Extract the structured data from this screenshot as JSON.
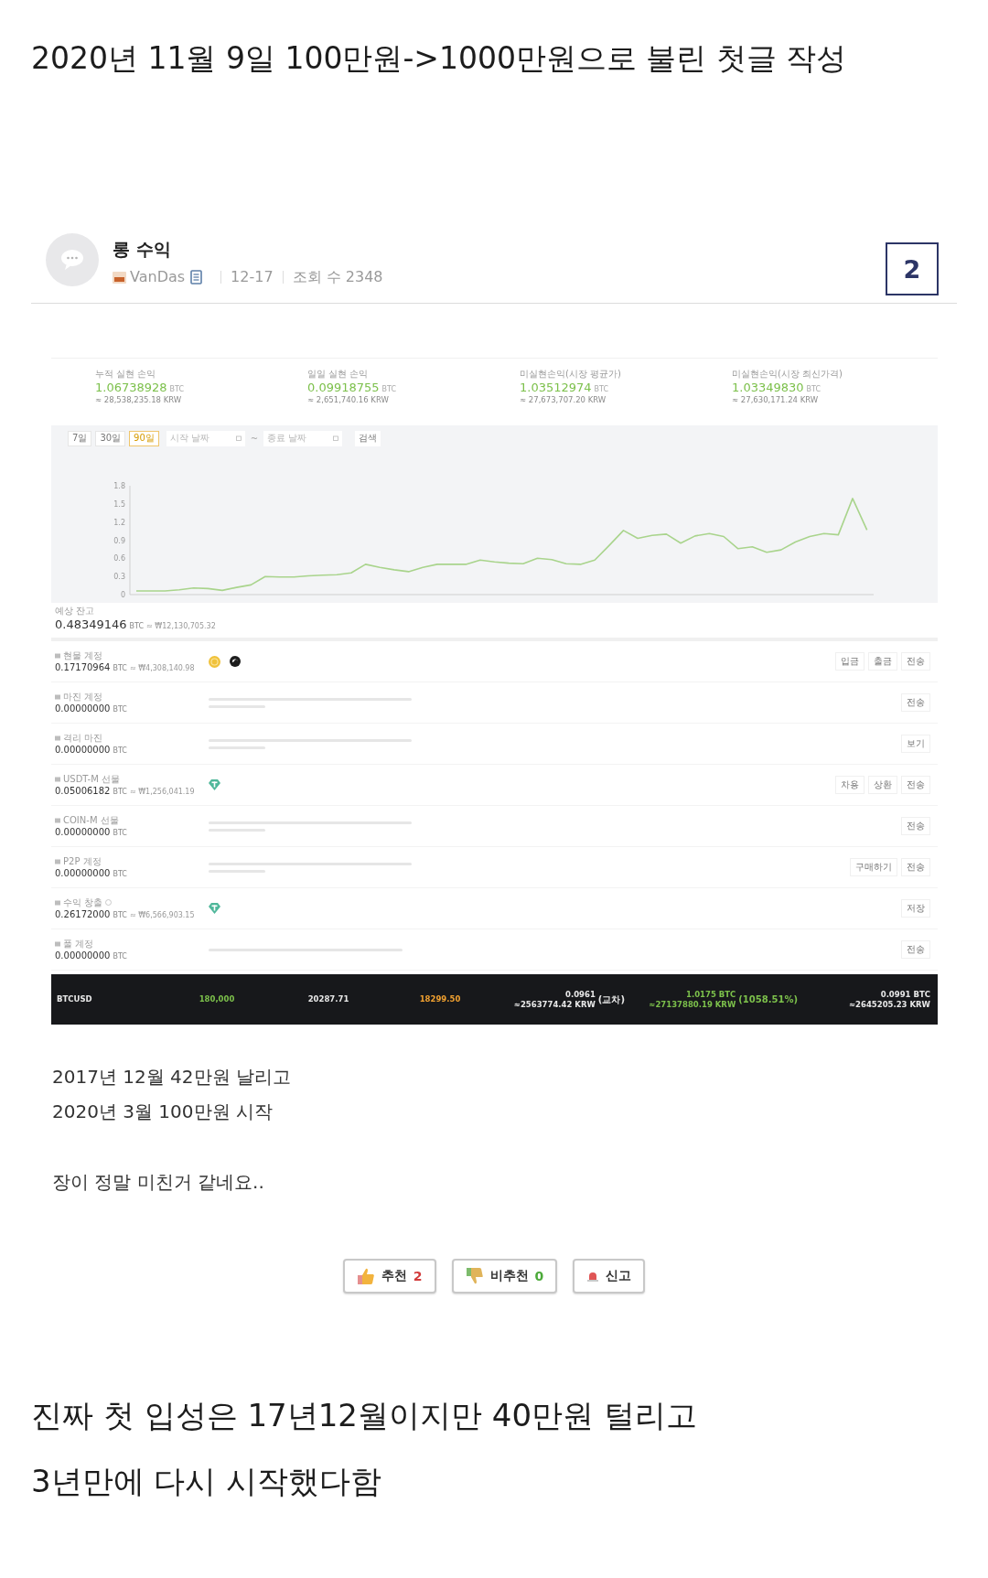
{
  "headline": "2020년 11월 9일 100만원->1000만원으로 불린 첫글 작성",
  "post": {
    "title": "롱 수익",
    "author": "VanDas",
    "date": "12-17",
    "views": "조회 수 2348",
    "marker": "2"
  },
  "dashboard": {
    "stats": [
      {
        "label": "누적 실현 손익",
        "value": "1.06738928",
        "unit": "BTC",
        "sub": "≈ 28,538,235.18 KRW"
      },
      {
        "label": "일일 실현 손익",
        "value": "0.09918755",
        "unit": "BTC",
        "sub": "≈ 2,651,740.16 KRW"
      },
      {
        "label": "미실현손익(시장 평균가)",
        "value": "1.03512974",
        "unit": "BTC",
        "sub": "≈ 27,673,707.20 KRW"
      },
      {
        "label": "미실현손익(시장 최신가격)",
        "value": "1.03349830",
        "unit": "BTC",
        "sub": "≈ 27,630,171.24 KRW"
      }
    ],
    "filters": [
      {
        "label": "7일",
        "selected": false
      },
      {
        "label": "30일",
        "selected": false
      },
      {
        "label": "90일",
        "selected": true
      }
    ],
    "date_from": {
      "placeholder": "시작 날짜"
    },
    "date_separator": "~",
    "date_to": {
      "placeholder": "종료 날짜"
    },
    "search_button": "검색",
    "chart_data": {
      "type": "line",
      "categories": [
        null,
        null,
        null,
        null,
        null,
        null,
        null,
        null,
        null,
        null,
        null,
        null,
        null,
        null,
        null,
        null,
        null,
        null,
        null,
        null,
        null,
        null,
        null,
        null,
        null,
        null,
        null,
        null,
        null,
        null,
        null,
        null,
        null,
        null,
        null,
        null,
        null,
        null,
        null,
        null,
        null,
        null,
        null,
        null,
        null,
        null,
        null,
        null,
        null,
        null,
        null,
        null
      ],
      "series": [
        {
          "color": "#a9d48c",
          "values": [
            0.06,
            0.06,
            0.06,
            0.08,
            0.11,
            0.1,
            0.07,
            0.12,
            0.16,
            0.3,
            0.29,
            0.29,
            0.31,
            0.32,
            0.33,
            0.36,
            0.5,
            0.45,
            0.41,
            0.38,
            0.45,
            0.5,
            0.5,
            0.5,
            0.57,
            0.54,
            0.52,
            0.51,
            0.6,
            0.58,
            0.51,
            0.5,
            0.57,
            0.81,
            1.06,
            0.93,
            0.98,
            1.0,
            0.85,
            0.97,
            1.01,
            0.96,
            0.76,
            0.79,
            0.7,
            0.74,
            0.87,
            0.96,
            1.01,
            0.99,
            1.59,
            1.07
          ]
        }
      ],
      "ylim": [
        0,
        1.8
      ],
      "yticks": [
        0,
        0.3,
        0.6,
        0.9,
        1.2,
        1.5,
        1.8
      ]
    },
    "balance": {
      "label": "예상 잔고",
      "value": "0.48349146",
      "unit": "BTC",
      "sub": "≈ ₩12,130,705.32"
    },
    "accounts": [
      {
        "label": "현물 계정",
        "value": "0.17170964",
        "unit": "BTC",
        "sub": "≈ ₩4,308,140.98",
        "info": false,
        "kind": "coins",
        "actions": [
          "입금",
          "출금",
          "전송"
        ]
      },
      {
        "label": "마진 계정",
        "value": "0.00000000",
        "unit": "BTC",
        "info": false,
        "kind": "text",
        "actions": [
          "전송"
        ]
      },
      {
        "label": "격리 마진",
        "value": "0.00000000",
        "unit": "BTC",
        "info": false,
        "kind": "text",
        "actions": [
          "보기"
        ]
      },
      {
        "label": "USDT-M 선물",
        "value": "0.05006182",
        "unit": "BTC",
        "sub": "≈ ₩1,256,041.19",
        "info": false,
        "kind": "token",
        "actions": [
          "차용",
          "상환",
          "전송"
        ]
      },
      {
        "label": "COIN-M 선물",
        "value": "0.00000000",
        "unit": "BTC",
        "info": false,
        "kind": "text",
        "actions": [
          "전송"
        ]
      },
      {
        "label": "P2P 계정",
        "value": "0.00000000",
        "unit": "BTC",
        "info": false,
        "kind": "text",
        "actions": [
          "구매하기",
          "전송"
        ]
      },
      {
        "label": "수익 창출",
        "value": "0.26172000",
        "unit": "BTC",
        "sub": "≈ ₩6,566,903.15",
        "info": true,
        "kind": "token",
        "actions": [
          "저장"
        ]
      },
      {
        "label": "풀 계정",
        "value": "0.00000000",
        "unit": "BTC",
        "info": false,
        "kind": "line",
        "actions": [
          "전송"
        ]
      }
    ],
    "ticker": [
      {
        "lines": [
          "BTCUSD"
        ],
        "color": "#e8e8e8"
      },
      {
        "lines": [
          "180,000"
        ],
        "color": "#7cc04b"
      },
      {
        "lines": [
          "20287.71"
        ],
        "color": "#e8e8e8"
      },
      {
        "lines": [
          "18299.50"
        ],
        "color": "#f0a030"
      },
      {
        "lines": [
          "0.0961",
          "≈2563774.42 KRW"
        ],
        "note": "(교차)",
        "color": "#e8e8e8"
      },
      {
        "lines": [
          "1.0175 BTC",
          "≈27137880.19 KRW"
        ],
        "note": "(1058.51%)",
        "color": "#7cc04b"
      },
      {
        "lines": [
          "0.0991 BTC",
          "≈2645205.23 KRW"
        ],
        "color": "#e8e8e8"
      }
    ]
  },
  "body": [
    "2017년 12월 42만원 날리고",
    "2020년 3월 100만원 시작",
    "장이 정말 미친거 같네요.."
  ],
  "votes": [
    {
      "kind": "up",
      "label": "추천",
      "count": "2"
    },
    {
      "kind": "down",
      "label": "비추천",
      "count": "0"
    },
    {
      "kind": "report",
      "label": "신고"
    }
  ],
  "footer": [
    "진짜 첫 입성은 17년12월이지만 40만원 털리고",
    "3년만에 다시 시작했다함"
  ]
}
